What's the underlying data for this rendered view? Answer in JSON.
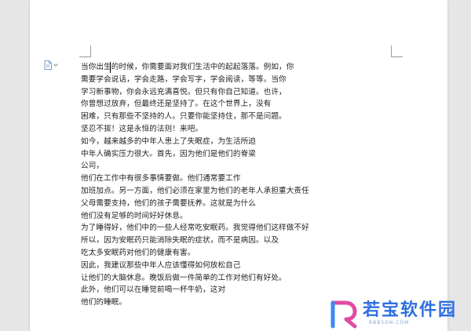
{
  "document": {
    "lines": [
      "当你出生的时候，你需要面对我们生活中的起起落落。例如，你",
      "需要学会说话，学会走路，学会写字，学会阅读，等等。当你",
      "学习新事物，你会永远充满喜悦。但只有你自己知道。也许，",
      "你曾想过放弃，但最终还是坚持了。在这个世界上，没有",
      "困难，只有那些不坚持的人。只要你能坚持住，那不是问题。",
      "坚忍不拔！这是永恒的法则！来吧。",
      "如今，越来越多的中年人患上了失眠症，为生活所迫",
      "中年人确实压力很大。首先，因为他们是他们的脊梁",
      "公司，",
      "他们在工作中有很多事情要做。他们通常要工作",
      "加班加点。另一方面，他们必须在家里为他们的老年人承担重大责任",
      "父母需要支持，他们的孩子需要抚养。这就是为什么",
      "他们没有足够的时间好好休息。",
      "为了睡得好，他们中的一些人经常吃安眠药。我觉得他们这样做不好",
      "所以，因为安眠药只能消除失眠的症状，而不是病因。以及",
      "吃太多安眠药对他们的健康有害。",
      "因此，我建议那些中年人应该懂得如何放松自己",
      "让他们的大脑休息。晚饭后做一件简单的工作对他们有好处。",
      "此外，他们可以在睡觉前喝一杯牛奶，这对",
      "他们的睡眠。"
    ]
  },
  "watermark": {
    "title": "若宝软件园",
    "url": "RBBSON.COM"
  },
  "icons": {
    "doc": "document-icon",
    "chevron": "chevron-down-icon"
  },
  "colors": {
    "brand": "#2f6fe0",
    "logo_pink": "#e04ba0",
    "logo_blue": "#3a8af0"
  }
}
